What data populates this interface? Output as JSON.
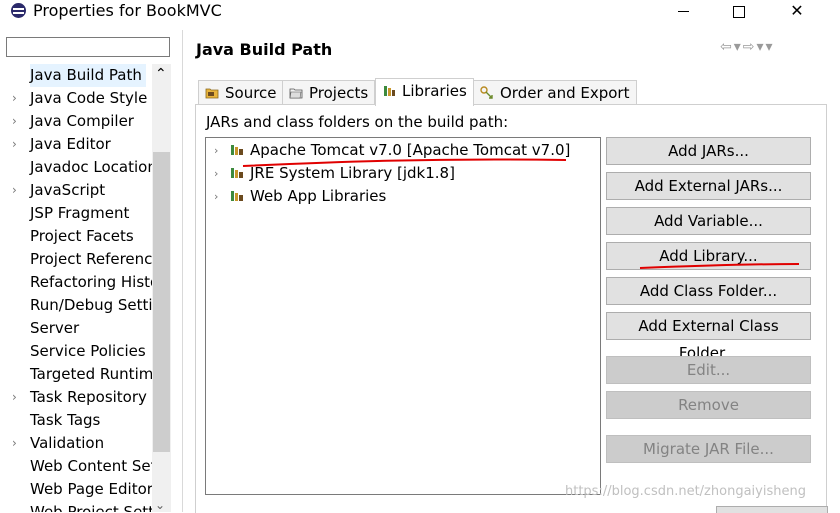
{
  "window": {
    "title": "Properties for BookMVC",
    "minimize": "",
    "maximize": "",
    "close": "✕"
  },
  "sidebar": {
    "filter_value": "",
    "items": [
      {
        "label": "Java Build Path",
        "arrow": "",
        "selected": true
      },
      {
        "label": "Java Code Style",
        "arrow": "›"
      },
      {
        "label": "Java Compiler",
        "arrow": "›"
      },
      {
        "label": "Java Editor",
        "arrow": "›"
      },
      {
        "label": "Javadoc Location",
        "arrow": ""
      },
      {
        "label": "JavaScript",
        "arrow": "›"
      },
      {
        "label": "JSP Fragment",
        "arrow": ""
      },
      {
        "label": "Project Facets",
        "arrow": ""
      },
      {
        "label": "Project References",
        "arrow": ""
      },
      {
        "label": "Refactoring History",
        "arrow": ""
      },
      {
        "label": "Run/Debug Settings",
        "arrow": ""
      },
      {
        "label": "Server",
        "arrow": ""
      },
      {
        "label": "Service Policies",
        "arrow": ""
      },
      {
        "label": "Targeted Runtimes",
        "arrow": ""
      },
      {
        "label": "Task Repository",
        "arrow": "›"
      },
      {
        "label": "Task Tags",
        "arrow": ""
      },
      {
        "label": "Validation",
        "arrow": "›"
      },
      {
        "label": "Web Content Settings",
        "arrow": ""
      },
      {
        "label": "Web Page Editor",
        "arrow": ""
      },
      {
        "label": "Web Project Settings",
        "arrow": ""
      }
    ],
    "scroll_up": "⌃",
    "scroll_down": "⌄"
  },
  "main": {
    "title": "Java Build Path",
    "nav": "⇦▾⇨▾▾",
    "tabs": [
      {
        "label": "Source",
        "icon": "source-folder-icon"
      },
      {
        "label": "Projects",
        "icon": "projects-folder-icon"
      },
      {
        "label": "Libraries",
        "icon": "libraries-icon",
        "active": true
      },
      {
        "label": "Order and Export",
        "icon": "order-export-icon"
      }
    ],
    "subtitle": "JARs and class folders on the build path:",
    "libraries": [
      {
        "label": "Apache Tomcat v7.0 [Apache Tomcat v7.0]",
        "arrow": "›"
      },
      {
        "label": "JRE System Library [jdk1.8]",
        "arrow": "›"
      },
      {
        "label": "Web App Libraries",
        "arrow": "›"
      }
    ],
    "buttons": [
      {
        "label": "Add JARs...",
        "enabled": true
      },
      {
        "label": "Add External JARs...",
        "enabled": true
      },
      {
        "label": "Add Variable...",
        "enabled": true
      },
      {
        "label": "Add Library...",
        "enabled": true
      },
      {
        "label": "Add Class Folder...",
        "enabled": true
      },
      {
        "label": "Add External Class Folder...",
        "enabled": true
      },
      {
        "label": "Edit...",
        "enabled": false
      },
      {
        "label": "Remove",
        "enabled": false
      },
      {
        "label": "Migrate JAR File...",
        "enabled": false
      }
    ]
  },
  "watermark": "https://blog.csdn.net/zhongaiyisheng",
  "colors": {
    "annotation_red": "#e00000",
    "selection": "#e5f3ff",
    "button_bg": "#e1e1e1",
    "button_disabled_bg": "#cccccc"
  }
}
